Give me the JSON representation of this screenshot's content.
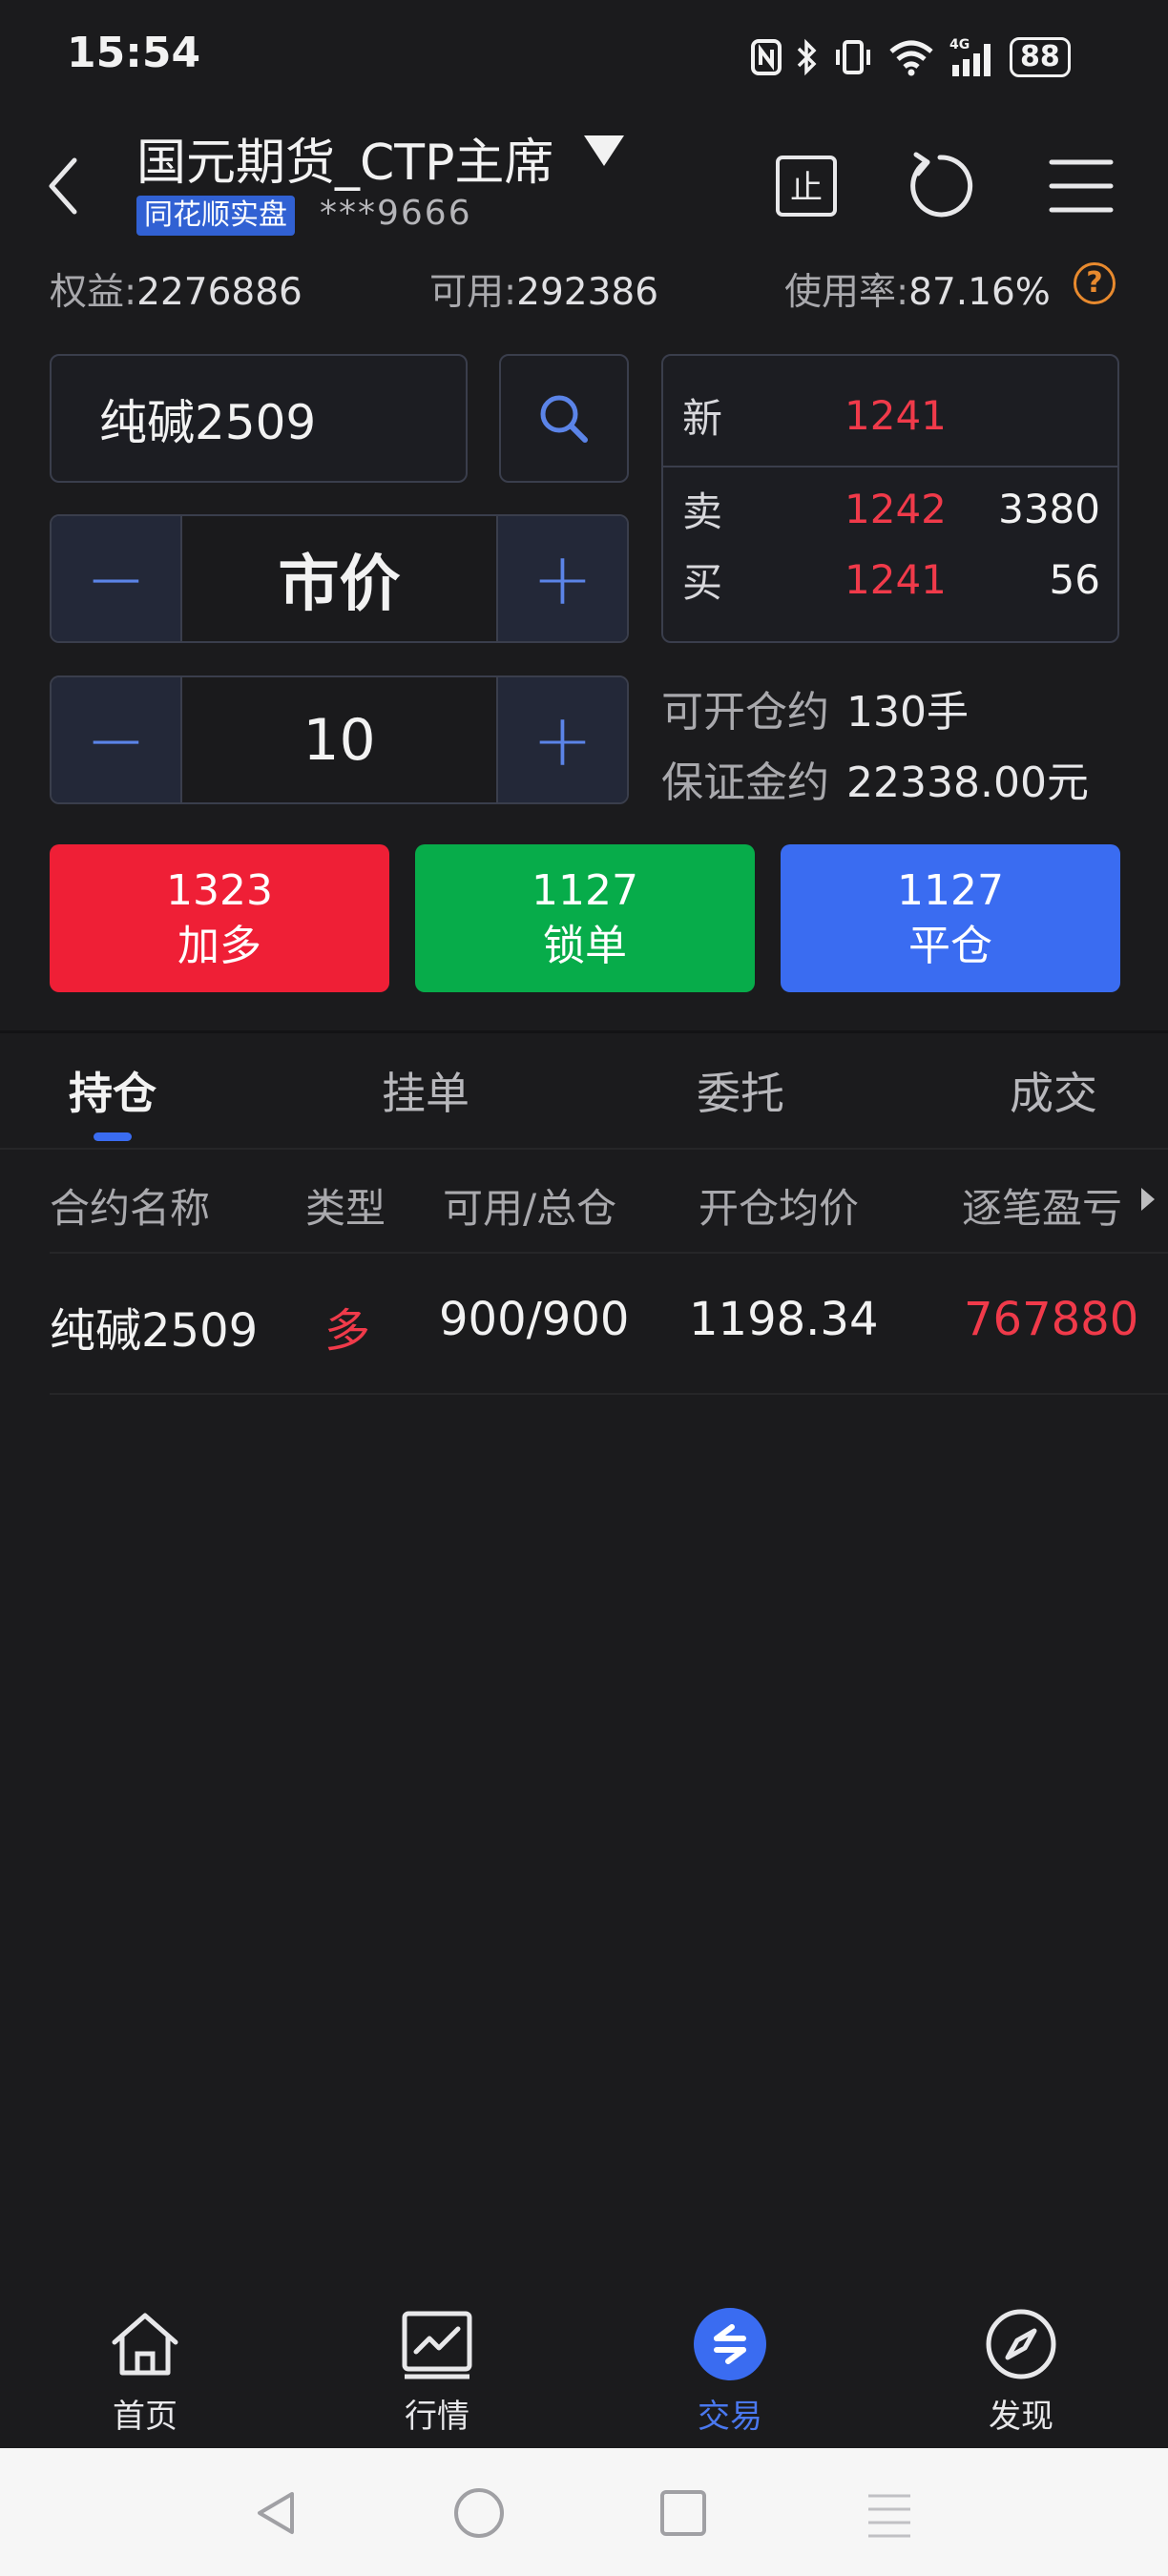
{
  "status_bar": {
    "time": "15:54",
    "network": "4G",
    "battery": "88"
  },
  "header": {
    "account_name": "国元期货_CTP主席",
    "badge": "同花顺实盘",
    "account_masked": "***9666",
    "stop_label": "止"
  },
  "account": {
    "equity_label": "权益:",
    "equity": "2276886",
    "available_label": "可用:",
    "available": "292386",
    "usage_label": "使用率:",
    "usage": "87.16%",
    "help": "?"
  },
  "order": {
    "contract": "纯碱2509",
    "price_mode": "市价",
    "quantity": "10",
    "minus": "−",
    "plus": "+"
  },
  "quote": {
    "new_label": "新",
    "new_price": "1241",
    "ask_label": "卖",
    "ask_price": "1242",
    "ask_volume": "3380",
    "bid_label": "买",
    "bid_price": "1241",
    "bid_volume": "56"
  },
  "info": {
    "open_label": "可开仓约",
    "open_value": "130手",
    "margin_label": "保证金约",
    "margin_value": "22338.00元"
  },
  "actions": [
    {
      "price": "1323",
      "label": "加多",
      "color": "#ef1f36"
    },
    {
      "price": "1127",
      "label": "锁单",
      "color": "#07ac4a"
    },
    {
      "price": "1127",
      "label": "平仓",
      "color": "#3a6cf1"
    }
  ],
  "tabs": [
    "持仓",
    "挂单",
    "委托",
    "成交"
  ],
  "table": {
    "headers": [
      "合约名称",
      "类型",
      "可用/总仓",
      "开仓均价",
      "逐笔盈亏"
    ],
    "rows": [
      {
        "name": "纯碱2509",
        "type": "多",
        "available_total": "900/900",
        "avg_price": "1198.34",
        "pnl": "767880"
      }
    ]
  },
  "bottom_nav": [
    {
      "label": "首页",
      "icon": "home-icon"
    },
    {
      "label": "行情",
      "icon": "chart-icon"
    },
    {
      "label": "交易",
      "icon": "trade-icon",
      "active": true
    },
    {
      "label": "发现",
      "icon": "compass-icon"
    }
  ],
  "colors": {
    "accent": "#3a6cf1",
    "up_red": "#f03a4a",
    "green": "#07ac4a",
    "background": "#1b1b1d"
  }
}
